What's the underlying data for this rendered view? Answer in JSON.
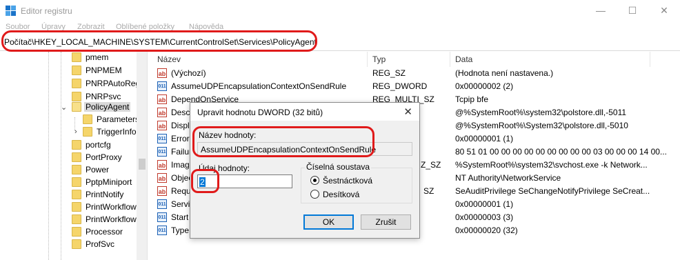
{
  "window": {
    "title": "Editor registru",
    "minimize_glyph": "—",
    "maximize_glyph": "☐",
    "close_glyph": "✕"
  },
  "menu": [
    "Soubor",
    "Úpravy",
    "Zobrazit",
    "Oblíbené položky",
    "Nápověda"
  ],
  "address": "Počítač\\HKEY_LOCAL_MACHINE\\SYSTEM\\CurrentControlSet\\Services\\PolicyAgent",
  "tree": {
    "items": [
      {
        "label": "pmem",
        "expanded": false,
        "selected": false,
        "child": false
      },
      {
        "label": "PNPMEM",
        "expanded": false,
        "selected": false,
        "child": false
      },
      {
        "label": "PNRPAutoReg",
        "expanded": false,
        "selected": false,
        "child": false
      },
      {
        "label": "PNRPsvc",
        "expanded": false,
        "selected": false,
        "child": false
      },
      {
        "label": "PolicyAgent",
        "expanded": true,
        "selected": true,
        "child": false
      },
      {
        "label": "Parameters",
        "expanded": false,
        "selected": false,
        "child": true
      },
      {
        "label": "TriggerInfo",
        "expanded": false,
        "selected": false,
        "child": true
      },
      {
        "label": "portcfg",
        "expanded": false,
        "selected": false,
        "child": false
      },
      {
        "label": "PortProxy",
        "expanded": false,
        "selected": false,
        "child": false
      },
      {
        "label": "Power",
        "expanded": false,
        "selected": false,
        "child": false
      },
      {
        "label": "PptpMiniport",
        "expanded": false,
        "selected": false,
        "child": false
      },
      {
        "label": "PrintNotify",
        "expanded": false,
        "selected": false,
        "child": false
      },
      {
        "label": "PrintWorkflow",
        "expanded": false,
        "selected": false,
        "child": false
      },
      {
        "label": "PrintWorkflow",
        "expanded": false,
        "selected": false,
        "child": false
      },
      {
        "label": "Processor",
        "expanded": false,
        "selected": false,
        "child": false
      },
      {
        "label": "ProfSvc",
        "expanded": false,
        "selected": false,
        "child": false
      }
    ]
  },
  "values_pane": {
    "headers": {
      "name": "Název",
      "type": "Typ",
      "data": "Data"
    },
    "rows": [
      {
        "name": "(Výchozí)",
        "type": "REG_SZ",
        "data": "(Hodnota není nastavena.)",
        "icon": "string-value-icon"
      },
      {
        "name": "AssumeUDPEncapsulationContextOnSendRule",
        "type": "REG_DWORD",
        "data": "0x00000002 (2)",
        "icon": "binary-value-icon"
      },
      {
        "name": "DependOnService",
        "type": "REG_MULTI_SZ",
        "data": "Tcpip bfe",
        "icon": "string-value-icon"
      },
      {
        "name": "Descri",
        "type": "",
        "data": "@%SystemRoot%\\system32\\polstore.dll,-5011",
        "icon": "string-value-icon"
      },
      {
        "name": "Displa",
        "type": "",
        "data": "@%SystemRoot%\\System32\\polstore.dll,-5010",
        "icon": "string-value-icon"
      },
      {
        "name": "ErrorC",
        "type": "",
        "data": "0x00000001 (1)",
        "icon": "binary-value-icon"
      },
      {
        "name": "Failure",
        "type": "",
        "data": "80 51 01 00 00 00 00 00 00 00 00 00 03 00 00 00 14 00...",
        "icon": "binary-value-icon"
      },
      {
        "name": "Image",
        "type": "Z_SZ",
        "data": "%SystemRoot%\\system32\\svchost.exe -k Network...",
        "icon": "string-value-icon"
      },
      {
        "name": "Objec",
        "type": "",
        "data": "NT Authority\\NetworkService",
        "icon": "string-value-icon"
      },
      {
        "name": "Requi",
        "type": "SZ",
        "data": "SeAuditPrivilege SeChangeNotifyPrivilege SeCreat...",
        "icon": "string-value-icon"
      },
      {
        "name": "Servic",
        "type": "",
        "data": "0x00000001 (1)",
        "icon": "binary-value-icon"
      },
      {
        "name": "Start",
        "type": "",
        "data": "0x00000003 (3)",
        "icon": "binary-value-icon"
      },
      {
        "name": "Type",
        "type": "",
        "data": "0x00000020 (32)",
        "icon": "binary-value-icon"
      }
    ]
  },
  "dialog": {
    "title": "Upravit hodnotu DWORD (32 bitů)",
    "name_label": "Název hodnoty:",
    "name_value": "AssumeUDPEncapsulationContextOnSendRule",
    "data_label": "Údaj hodnoty:",
    "data_value": "2",
    "base_label": "Číselná soustava",
    "base_hex": "Šestnáctková",
    "base_dec": "Desítková",
    "ok": "OK",
    "cancel": "Zrušit",
    "close_glyph": "✕"
  },
  "colors": {
    "annotation_red": "#e01a1a",
    "selection_blue": "#0078d7",
    "folder_yellow": "#f5d56b"
  }
}
